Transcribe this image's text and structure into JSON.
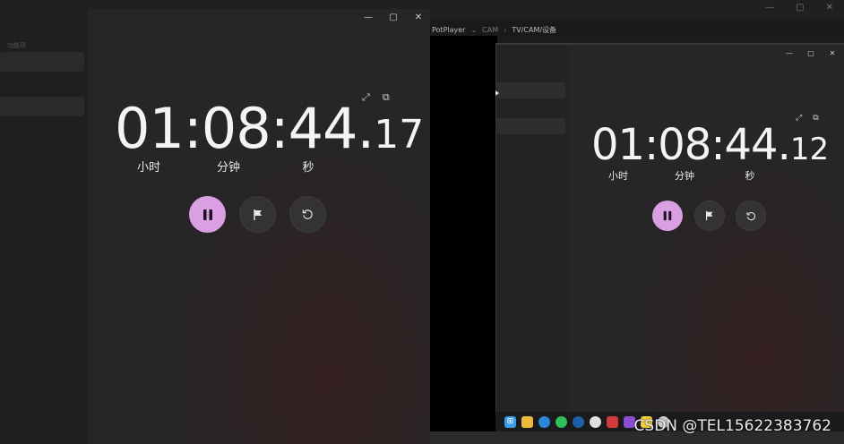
{
  "background": {
    "sidebar_label": "功能项",
    "window_controls": [
      "—",
      "▢",
      "✕"
    ],
    "potplayer_bar": {
      "app": "PotPlayer",
      "separator": "⌄",
      "items": [
        "CAM",
        "TV/CAM/设备"
      ]
    }
  },
  "stopwatch_main": {
    "window_controls": [
      "—",
      "▢",
      "✕"
    ],
    "time": {
      "hours": "01",
      "minutes": "08",
      "seconds": "44",
      "fraction": "17",
      "sep": ":",
      "dot": "."
    },
    "units": {
      "hours": "小时",
      "minutes": "分钟",
      "seconds": "秒"
    },
    "icons": {
      "expand": "expand-icon",
      "overlay": "compact-overlay-icon",
      "pause": "pause-icon",
      "lap": "flag-icon",
      "reset": "reset-icon"
    }
  },
  "stopwatch_secondary": {
    "window_controls": [
      "—",
      "▢",
      "✕"
    ],
    "time": {
      "hours": "01",
      "minutes": "08",
      "seconds": "44",
      "fraction": "12",
      "sep": ":",
      "dot": "."
    },
    "units": {
      "hours": "小时",
      "minutes": "分钟",
      "seconds": "秒"
    }
  },
  "taskbar": {
    "icons": [
      "windows-start-icon",
      "file-explorer-icon",
      "edge-icon",
      "wechat-icon",
      "app-icon",
      "music-icon",
      "app-red-icon",
      "app-purple-icon",
      "notes-icon",
      "clock-icon"
    ],
    "colors": {
      "accent": "#d99fe2"
    }
  },
  "watermark": "CSDN @TEL15622383762"
}
